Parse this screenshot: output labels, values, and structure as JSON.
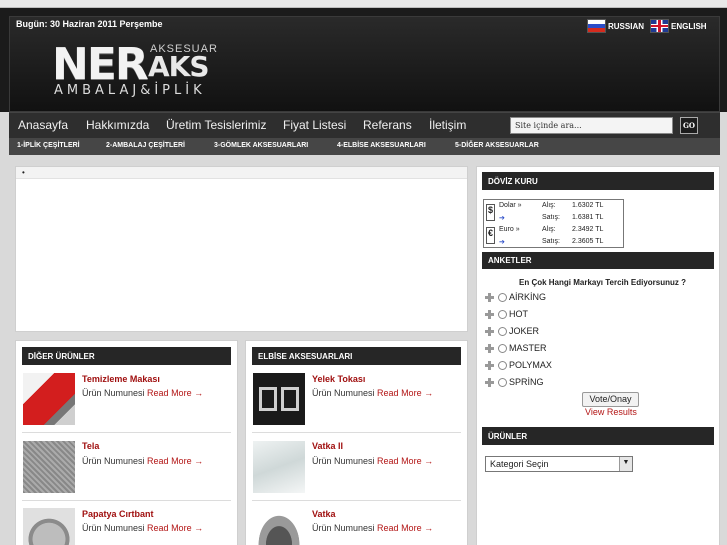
{
  "header": {
    "date": "Bugün: 30 Haziran 2011 Perşembe",
    "lang_ru": "RUSSIAN",
    "lang_en": "ENGLISH",
    "logo_main": "NER",
    "logo_aks": "AKS",
    "logo_aksesuar": "AKSESUAR",
    "logo_sub": "AMBALAJ&İPLİK"
  },
  "nav": {
    "items": [
      "Anasayfa",
      "Hakkımızda",
      "Üretim Tesislerimiz",
      "Fiyat Listesi",
      "Referans",
      "İletişim"
    ],
    "search_placeholder": "Site içinde ara...",
    "go_label": "GO"
  },
  "subnav": {
    "items": [
      "1-İPLİK ÇEŞİTLERİ",
      "2-AMBALAJ ÇEŞİTLERİ",
      "3-GÖMLEK AKSESUARLARI",
      "4-ELBİSE AKSESUARLARI",
      "5-DİĞER AKSESUARLAR"
    ]
  },
  "main": {
    "bullet": "•"
  },
  "diger": {
    "title": "DİĞER ÜRÜNLER",
    "items": [
      {
        "name": "Temizleme Makası",
        "sub": "Ürün Numunesi",
        "link": "Read More →"
      },
      {
        "name": "Tela",
        "sub": "Ürün Numunesi",
        "link": "Read More →"
      },
      {
        "name": "Papatya Cırtbant",
        "sub": "Ürün Numunesi",
        "link": "Read More →"
      }
    ]
  },
  "elbise": {
    "title": "ELBİSE AKSESUARLARI",
    "items": [
      {
        "name": "Yelek Tokası",
        "sub": "Ürün Numunesi",
        "link": "Read More →"
      },
      {
        "name": "Vatka II",
        "sub": "Ürün Numunesi",
        "link": "Read More →"
      },
      {
        "name": "Vatka",
        "sub": "Ürün Numunesi",
        "link": "Read More →"
      }
    ]
  },
  "doviz": {
    "title": "DÖVİZ KURU",
    "rows": [
      {
        "cur": "Dolar »",
        "type": "Alış:",
        "val": "1.6302 TL"
      },
      {
        "cur": "",
        "type": "Satış:",
        "val": "1.6381 TL"
      },
      {
        "cur": "Euro »",
        "type": "Alış:",
        "val": "2.3492 TL"
      },
      {
        "cur": "",
        "type": "Satış:",
        "val": "2.3605 TL"
      }
    ]
  },
  "anket": {
    "title": "ANKETLER",
    "question": "En Çok Hangi Markayı Tercih Ediyorsunuz ?",
    "options": [
      "AİRKİNG",
      "HOT",
      "JOKER",
      "MASTER",
      "POLYMAX",
      "SPRİNG"
    ],
    "vote_label": "Vote/Onay",
    "results_label": "View Results"
  },
  "urunler": {
    "title": "ÜRÜNLER",
    "select_value": "Kategori Seçin"
  },
  "colors": {
    "link": "#b31515",
    "bar": "#262626"
  }
}
